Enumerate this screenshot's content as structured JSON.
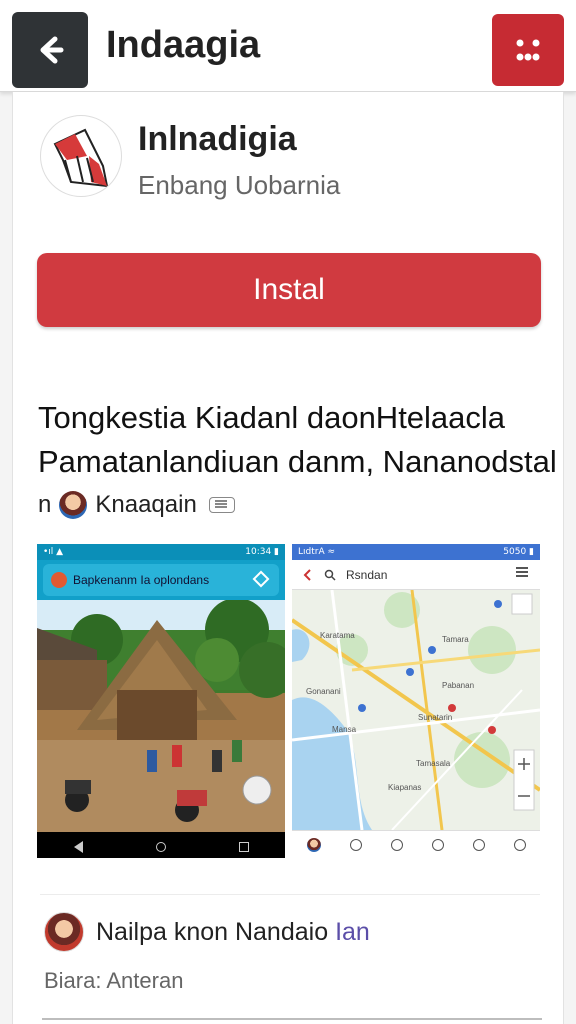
{
  "header": {
    "title": "Indaagia",
    "back_icon": "arrow-left-icon",
    "menu_icon": "dots-grid-icon",
    "accent_color": "#c62b33"
  },
  "app": {
    "name": "Inlnadigia",
    "developer": "Enbang Uobarnia",
    "logo_icon": "red-flag-logo",
    "install_label": "Instal",
    "install_color": "#d03a40"
  },
  "description": {
    "title": "Tongkestia Kiadanl daonHtelaacla",
    "subtitle": "Pamatanlandiuan danm, Nananodstal",
    "author_prefix": "n",
    "author_name": "Knaaqain"
  },
  "screenshots": [
    {
      "status_left": "•ıl ▲",
      "status_right": "10:34 ▮",
      "search_text": "Bapkenanm Ia oplondans"
    },
    {
      "status_left": "LıdtrA ≈",
      "status_right": "5050 ▮",
      "search_text": "Rsndan",
      "map_labels": [
        "Karatama",
        "Tamara",
        "Pabanan",
        "Gonanani",
        "Sunatarin",
        "Mansa",
        "Tamasala",
        "Kiapanas"
      ]
    }
  ],
  "review": {
    "name": "Nailpa knon Nandaio",
    "name_tag": "Ian",
    "subtitle": "Biara: Anteran"
  }
}
